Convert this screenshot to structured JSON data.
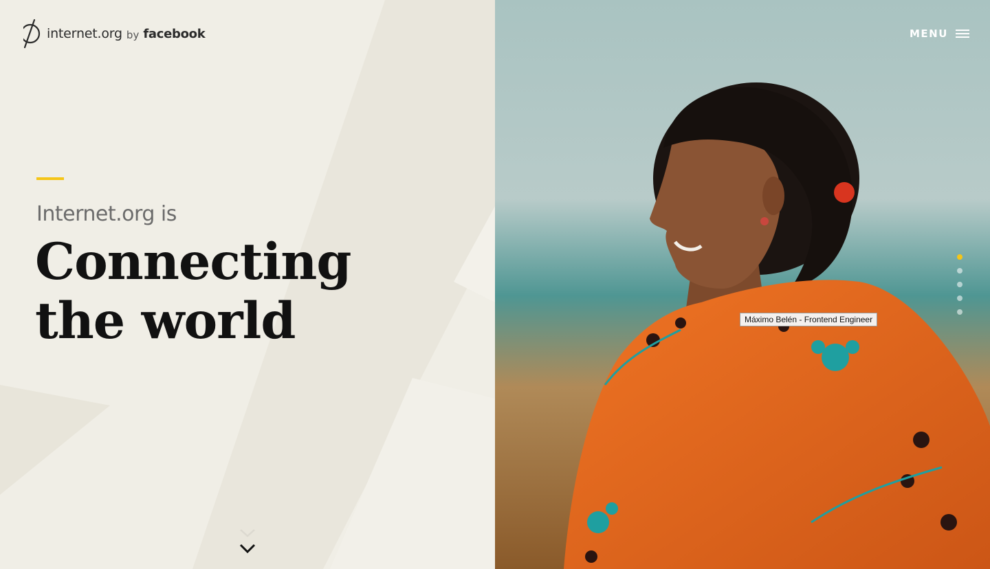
{
  "header": {
    "logo": {
      "name": "internet.org",
      "by": "by",
      "brand": "facebook"
    },
    "menu_label": "MENU"
  },
  "hero": {
    "intro": "Internet.org is",
    "headline_line1": "Connecting",
    "headline_line2": "the world"
  },
  "slider": {
    "count": 5,
    "active_index": 0
  },
  "tooltip": "Máximo Belén - Frontend Engineer",
  "colors": {
    "accent": "#f5c518",
    "background": "#f0eee6",
    "text": "#111111",
    "shawl": "#e36a1e"
  },
  "icons": {
    "scroll_down": "chevron-down-icon",
    "menu": "hamburger-icon",
    "logo": "internet-org-logo-icon"
  }
}
